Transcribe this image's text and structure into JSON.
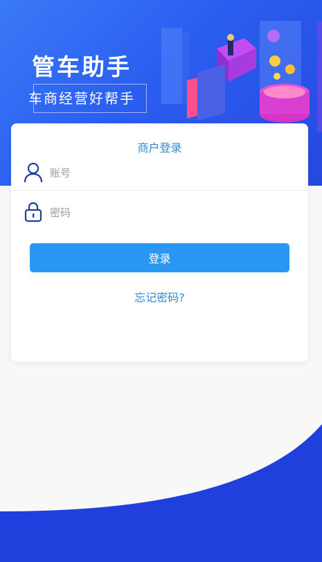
{
  "hero": {
    "title": "管车助手",
    "subtitle": "车商经营好帮手"
  },
  "login": {
    "title": "商户登录",
    "account_placeholder": "账号",
    "password_placeholder": "密码",
    "submit_label": "登录",
    "forgot_label": "忘记密码?"
  },
  "icons": {
    "account": "user-icon",
    "password": "lock-icon"
  },
  "colors": {
    "primary": "#2b97f5",
    "link": "#2f88d6",
    "hero_blue": "#2a5ef0",
    "wave_blue": "#2040de"
  }
}
